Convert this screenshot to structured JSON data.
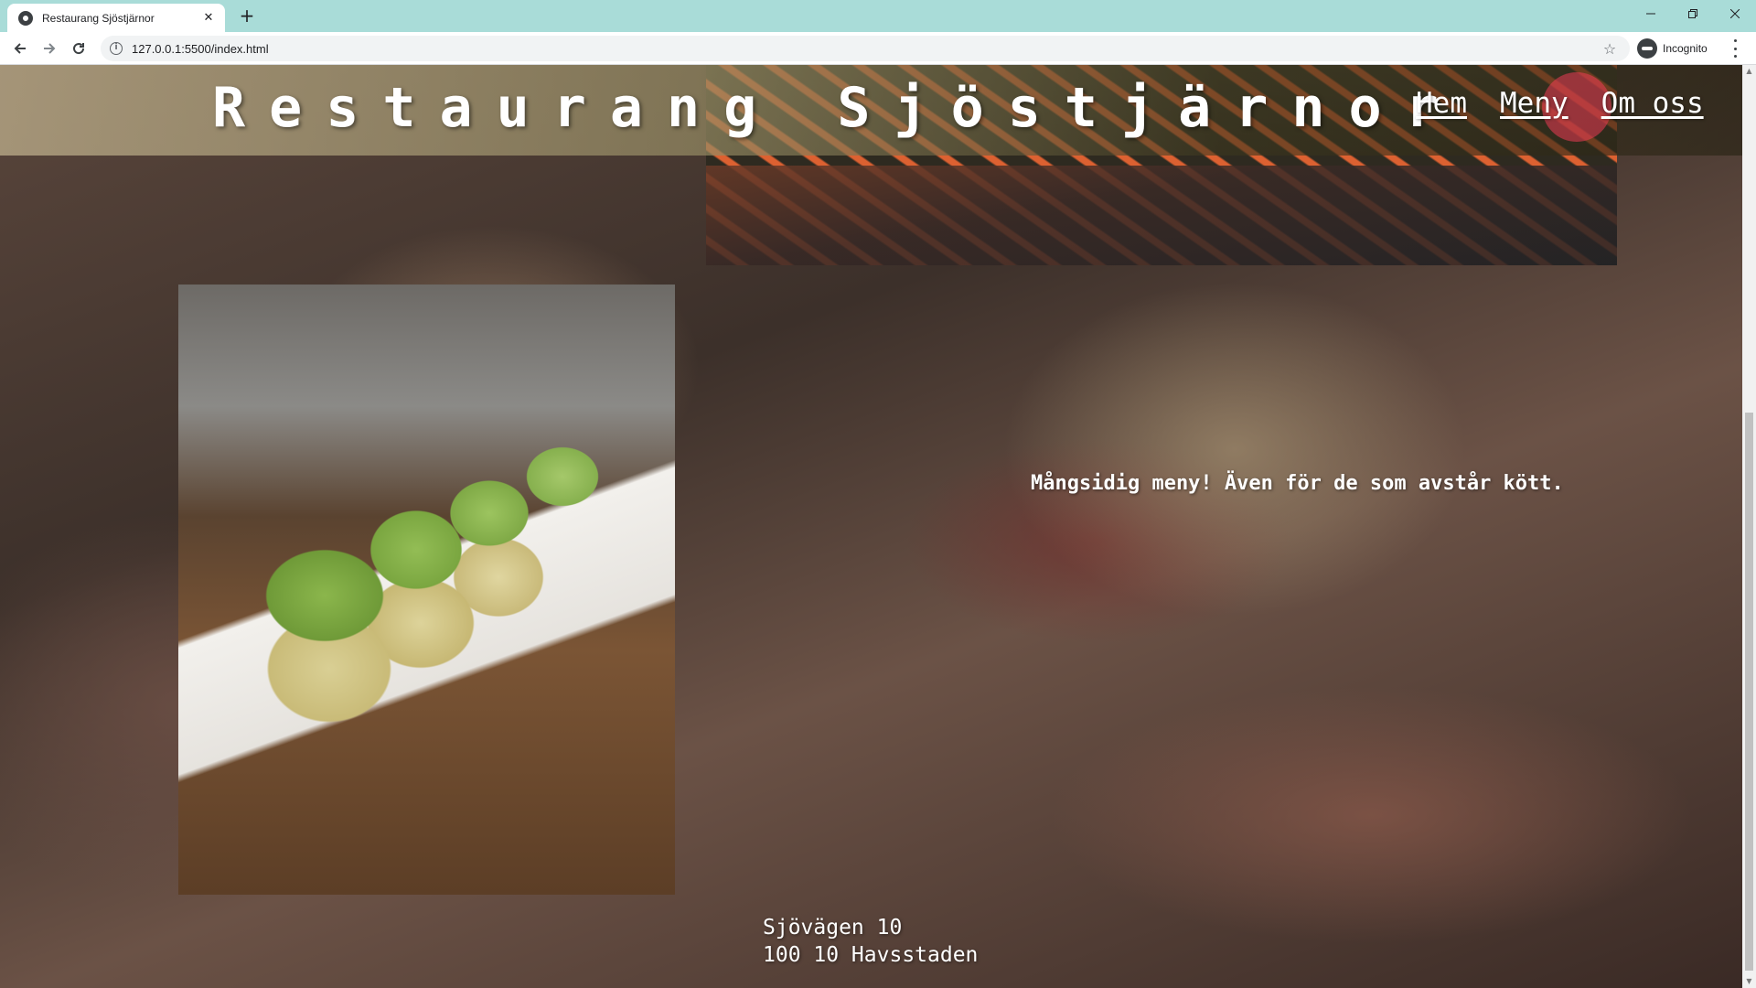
{
  "browser": {
    "tab_title": "Restaurang Sjöstjärnor",
    "tab_close": "✕",
    "new_tab": "+",
    "url": "127.0.0.1:5500/index.html",
    "profile_label": "Incognito",
    "icons": {
      "back": "arrow-left-icon",
      "forward": "arrow-right-icon",
      "reload": "reload-icon",
      "info": "info-icon",
      "bookmark": "star-icon",
      "minimize": "minimize-icon",
      "restore": "restore-icon",
      "close": "close-icon"
    },
    "colors": {
      "tabbar": "#a9dcd8",
      "toolbar": "#ffffff",
      "omnibox": "#f1f3f4"
    }
  },
  "site": {
    "title": "Restaurang Sjöstjärnor",
    "nav": [
      {
        "label": "Hem"
      },
      {
        "label": "Meny"
      },
      {
        "label": "Om oss"
      }
    ],
    "tagline": "Mångsidig meny! Även för de som avstår kött.",
    "address_line1": "Sjövägen 10",
    "address_line2": "100 10 Havsstaden",
    "colors": {
      "text": "#ffffff",
      "click_marker": "#ff3c5a"
    }
  }
}
